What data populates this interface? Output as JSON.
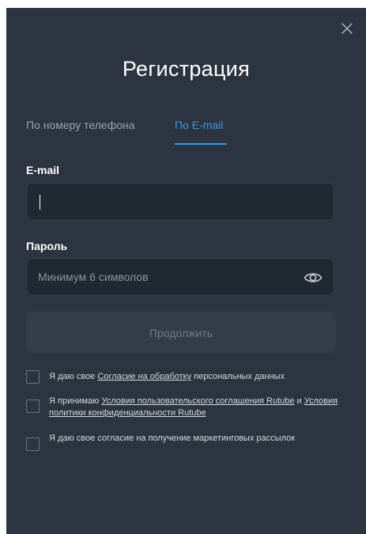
{
  "modal": {
    "title": "Регистрация",
    "close_icon": "close-icon"
  },
  "tabs": [
    {
      "label": "По номеру телефона",
      "active": false
    },
    {
      "label": "По E-mail",
      "active": true
    }
  ],
  "email": {
    "label": "E-mail",
    "value": "",
    "placeholder": ""
  },
  "password": {
    "label": "Пароль",
    "value": "",
    "placeholder": "Минимум 6 символов",
    "toggle_icon": "eye-icon"
  },
  "submit": {
    "label": "Продолжить",
    "enabled": false
  },
  "consents": [
    {
      "checked": false,
      "prefix": "Я даю свое ",
      "link1": "Согласие на обработку",
      "suffix": " персональных данных"
    },
    {
      "checked": false,
      "prefix": "Я принимаю ",
      "link1": "Условия пользовательского соглашения Rutube",
      "middle": " и ",
      "link2": "Условия политики конфиденциальности Rutube"
    },
    {
      "checked": false,
      "text": "Я даю свое согласие на получение маркетинговых рассылок"
    }
  ],
  "colors": {
    "modal_bg": "#2c3440",
    "input_bg": "#202831",
    "accent": "#2f9cf2",
    "button_disabled_bg": "#333c48"
  }
}
